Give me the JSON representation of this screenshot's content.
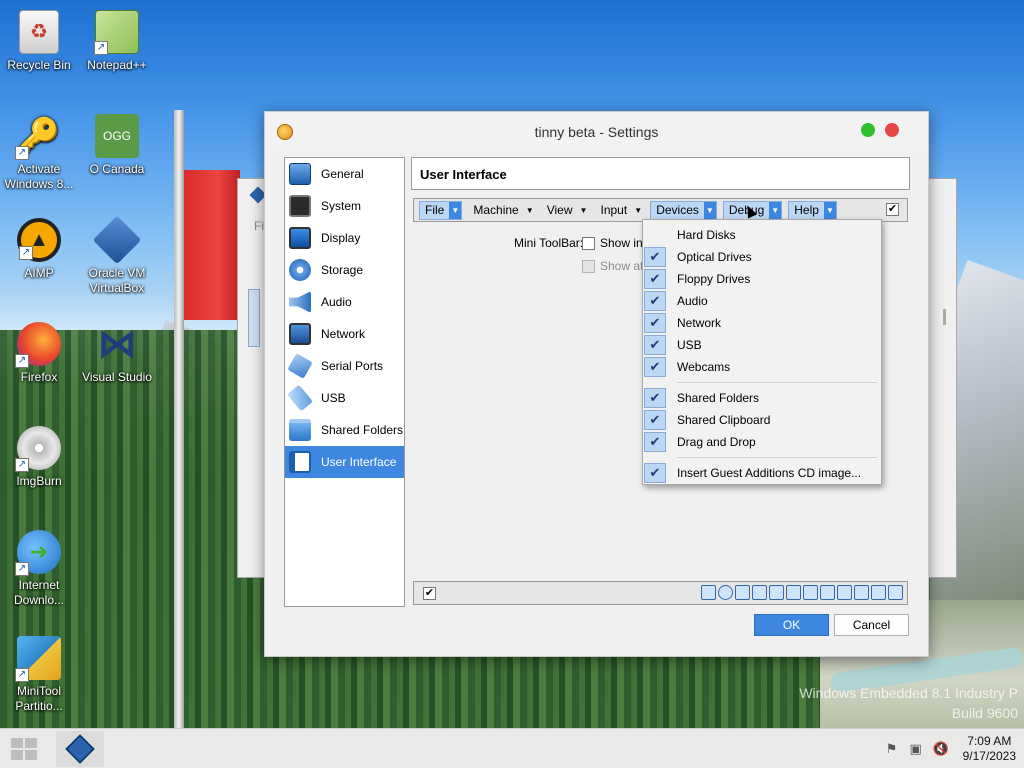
{
  "desktop": {
    "icons": [
      {
        "label": "Recycle Bin",
        "icon": "recycle-bin-icon"
      },
      {
        "label": "Notepad++",
        "icon": "notepad-plus-plus-icon"
      },
      {
        "label": "Activate Windows 8...",
        "icon": "key-icon"
      },
      {
        "label": "O Canada",
        "icon": "ogg-file-icon",
        "badge": "OGG"
      },
      {
        "label": "AIMP",
        "icon": "aimp-icon"
      },
      {
        "label": "Oracle VM VirtualBox",
        "icon": "virtualbox-icon"
      },
      {
        "label": "Firefox",
        "icon": "firefox-icon"
      },
      {
        "label": "Visual Studio",
        "icon": "visual-studio-icon"
      },
      {
        "label": "ImgBurn",
        "icon": "imgburn-icon"
      },
      {
        "label": "Internet Downlo...",
        "icon": "internet-download-manager-icon"
      },
      {
        "label": "MiniTool Partitio...",
        "icon": "minitool-partition-icon"
      }
    ],
    "watermark": {
      "line1": "Windows Embedded 8.1 Industry P",
      "line2": "Build 9600"
    }
  },
  "background_window": {
    "fragment": "Fi"
  },
  "dialog": {
    "title": "tinny beta - Settings",
    "sidebar": [
      {
        "label": "General",
        "icon": "general-icon"
      },
      {
        "label": "System",
        "icon": "system-chip-icon"
      },
      {
        "label": "Display",
        "icon": "display-monitor-icon"
      },
      {
        "label": "Storage",
        "icon": "storage-disk-icon"
      },
      {
        "label": "Audio",
        "icon": "speaker-icon"
      },
      {
        "label": "Network",
        "icon": "network-icon"
      },
      {
        "label": "Serial Ports",
        "icon": "serial-port-icon"
      },
      {
        "label": "USB",
        "icon": "usb-icon"
      },
      {
        "label": "Shared Folders",
        "icon": "folder-icon"
      },
      {
        "label": "User Interface",
        "icon": "user-interface-icon",
        "selected": true
      }
    ],
    "page_title": "User Interface",
    "menubar": {
      "items": [
        {
          "label": "File",
          "highlighted": true
        },
        {
          "label": "Machine",
          "highlighted": false
        },
        {
          "label": "View",
          "highlighted": false
        },
        {
          "label": "Input",
          "highlighted": false
        },
        {
          "label": "Devices",
          "highlighted": true
        },
        {
          "label": "Debug",
          "highlighted": true
        },
        {
          "label": "Help",
          "highlighted": true
        }
      ],
      "enabled_checked": true
    },
    "mini_toolbar": {
      "label": "Mini ToolBar:",
      "option1": "Show in F",
      "option2": "Show at"
    },
    "devices_menu": {
      "groups": [
        [
          {
            "label": "Hard Disks",
            "checked": false
          },
          {
            "label": "Optical Drives",
            "checked": true
          },
          {
            "label": "Floppy Drives",
            "checked": true
          },
          {
            "label": "Audio",
            "checked": true
          },
          {
            "label": "Network",
            "checked": true
          },
          {
            "label": "USB",
            "checked": true
          },
          {
            "label": "Webcams",
            "checked": true
          }
        ],
        [
          {
            "label": "Shared Folders",
            "checked": true
          },
          {
            "label": "Shared Clipboard",
            "checked": true
          },
          {
            "label": "Drag and Drop",
            "checked": true
          }
        ],
        [
          {
            "label": "Insert Guest Additions CD image...",
            "checked": true
          }
        ]
      ]
    },
    "statusbar": {
      "enabled_checked": true
    },
    "buttons": {
      "ok": "OK",
      "cancel": "Cancel"
    }
  },
  "taskbar": {
    "time": "7:09 AM",
    "date": "9/17/2023"
  },
  "colors": {
    "accent": "#3e87e0",
    "menu_highlight": "#bcd7f4"
  }
}
